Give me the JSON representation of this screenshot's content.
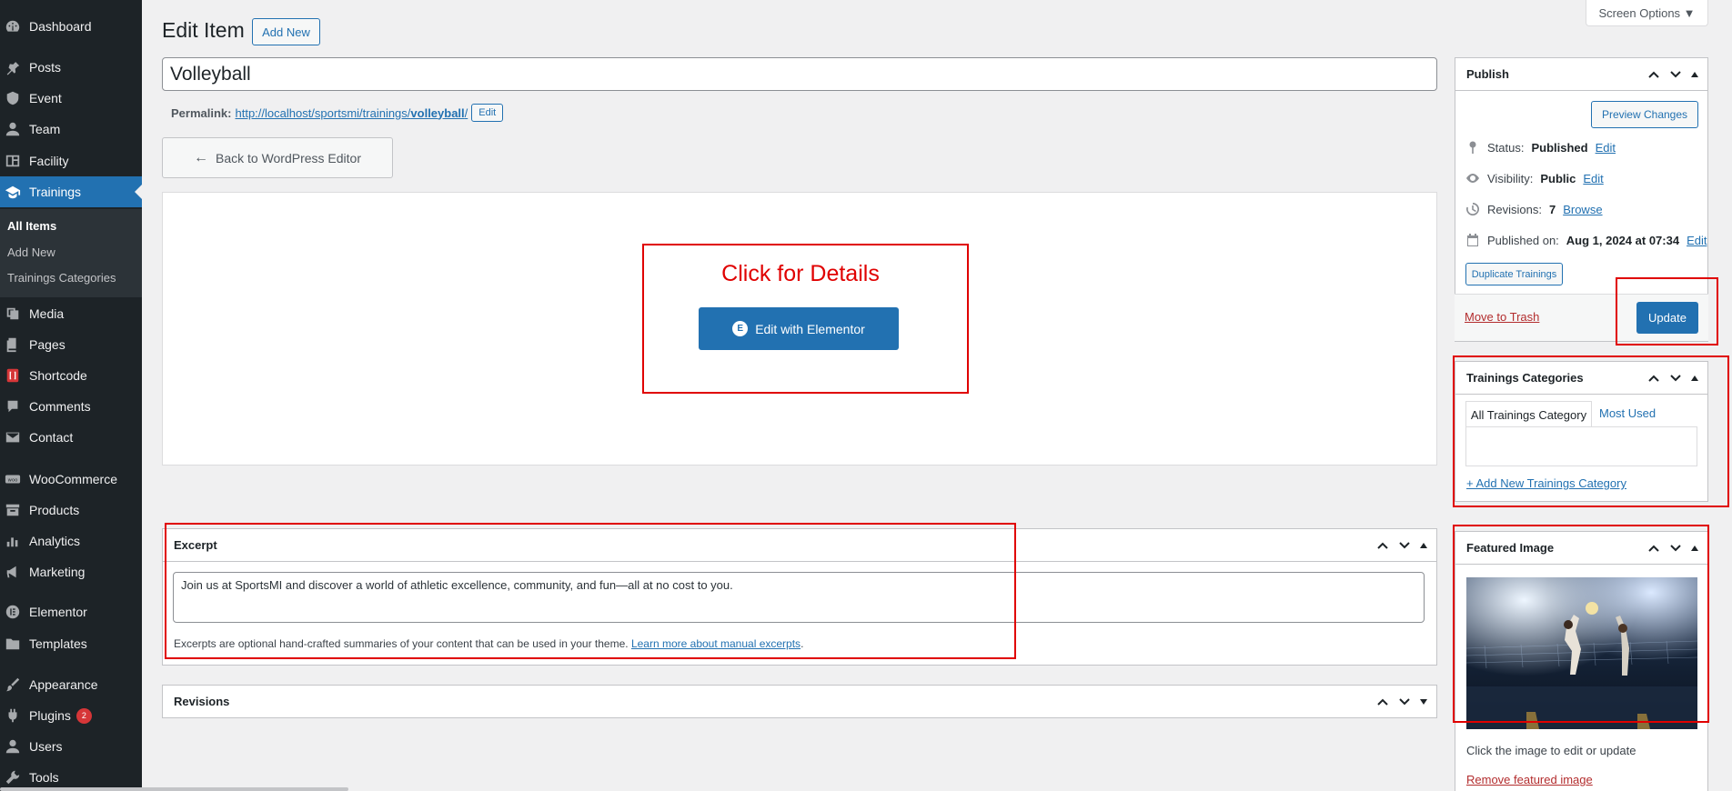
{
  "menu": {
    "items": [
      {
        "label": "Dashboard",
        "icon": "dashboard-icon"
      },
      {
        "label": "Posts",
        "icon": "pin-icon"
      },
      {
        "label": "Event",
        "icon": "shield-icon"
      },
      {
        "label": "Team",
        "icon": "user-icon"
      },
      {
        "label": "Facility",
        "icon": "building-icon"
      },
      {
        "label": "Trainings",
        "icon": "graduation-cap-icon"
      },
      {
        "label": "Media",
        "icon": "media-icon"
      },
      {
        "label": "Pages",
        "icon": "pages-icon"
      },
      {
        "label": "Shortcode",
        "icon": "shortcode-icon"
      },
      {
        "label": "Comments",
        "icon": "comment-icon"
      },
      {
        "label": "Contact",
        "icon": "mail-icon"
      },
      {
        "label": "WooCommerce",
        "icon": "woo-icon"
      },
      {
        "label": "Products",
        "icon": "archive-icon"
      },
      {
        "label": "Analytics",
        "icon": "bar-chart-icon"
      },
      {
        "label": "Marketing",
        "icon": "megaphone-icon"
      },
      {
        "label": "Elementor",
        "icon": "elementor-icon"
      },
      {
        "label": "Templates",
        "icon": "folder-icon"
      },
      {
        "label": "Appearance",
        "icon": "paintbrush-icon"
      },
      {
        "label": "Plugins",
        "icon": "plug-icon",
        "badge": "2"
      },
      {
        "label": "Users",
        "icon": "users-icon"
      },
      {
        "label": "Tools",
        "icon": "wrench-icon"
      }
    ],
    "submenu": [
      "All Items",
      "Add New",
      "Trainings Categories"
    ]
  },
  "header": {
    "title": "Edit Item",
    "add_new": "Add New",
    "screen_options": "Screen Options ▼"
  },
  "post": {
    "title": "Volleyball",
    "permalink_label": "Permalink:",
    "permalink_base": "http://localhost/sportsmi/trainings/",
    "permalink_slug": "volleyball",
    "permalink_tail": "/",
    "permalink_edit": "Edit"
  },
  "elementor": {
    "back_label": "Back to WordPress Editor",
    "annotation": "Click for Details",
    "edit_label": "Edit with Elementor"
  },
  "excerpt": {
    "title": "Excerpt",
    "text": "Join us at SportsMI and discover a world of athletic excellence, community, and fun—all at no cost to you.",
    "help": "Excerpts are optional hand-crafted summaries of your content that can be used in your theme.",
    "help_link": "Learn more about manual excerpts",
    "help_tail": "."
  },
  "revisions_box": {
    "title": "Revisions"
  },
  "publish": {
    "title": "Publish",
    "preview": "Preview Changes",
    "status_label": "Status:",
    "status_value": "Published",
    "visibility_label": "Visibility:",
    "visibility_value": "Public",
    "revisions_label": "Revisions:",
    "revisions_value": "7",
    "published_label": "Published on:",
    "published_value": "Aug 1, 2024 at 07:34",
    "edit": "Edit",
    "browse": "Browse",
    "duplicate": "Duplicate Trainings",
    "trash": "Move to Trash",
    "update": "Update"
  },
  "categories": {
    "title": "Trainings Categories",
    "tab_all": "All Trainings Category",
    "tab_used": "Most Used",
    "add_new": "+ Add New Trainings Category"
  },
  "featured": {
    "title": "Featured Image",
    "help": "Click the image to edit or update",
    "remove": "Remove featured image"
  },
  "colors": {
    "accent": "#2271b1",
    "menu_bg": "#1d2327",
    "annotation": "#e00000",
    "trash": "#b32d2e"
  }
}
